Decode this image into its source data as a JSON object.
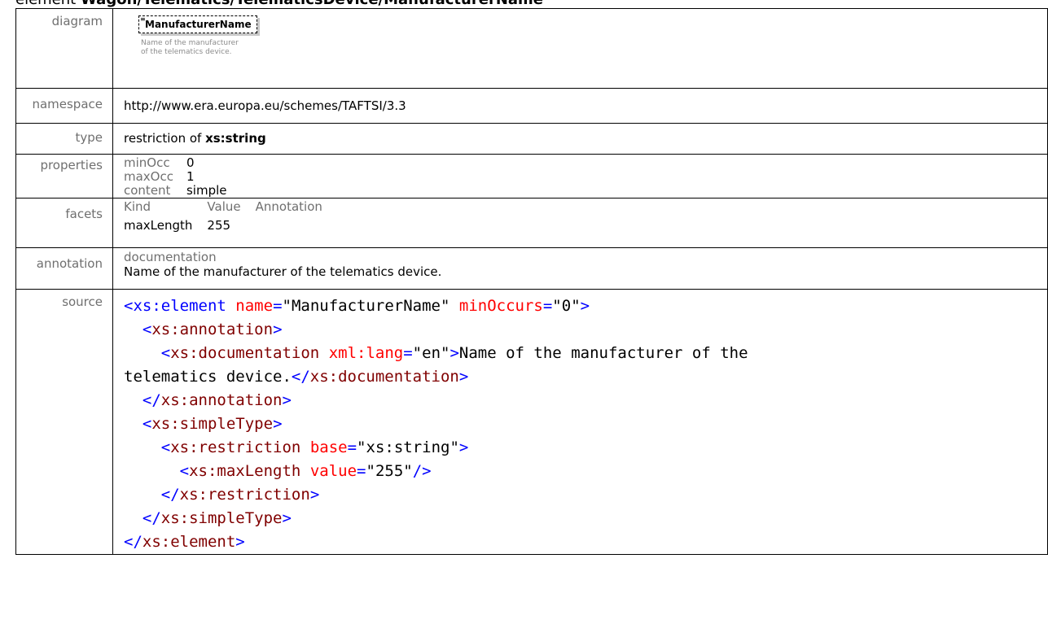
{
  "heading": {
    "prefix": "element ",
    "path": "Wagon/Telematics/TelematicsDevice/ManufacturerName"
  },
  "rows": {
    "diagram": {
      "label": "diagram",
      "element_name": "ManufacturerName",
      "doc_line1": "Name of the manufacturer",
      "doc_line2": "of the telematics device."
    },
    "namespace": {
      "label": "namespace",
      "value": "http://www.era.europa.eu/schemes/TAFTSI/3.3"
    },
    "type": {
      "label": "type",
      "prefix": "restriction of ",
      "base": "xs:string"
    },
    "properties": {
      "label": "properties",
      "items": [
        {
          "key": "minOcc",
          "value": "0"
        },
        {
          "key": "maxOcc",
          "value": "1"
        },
        {
          "key": "content",
          "value": "simple"
        }
      ]
    },
    "facets": {
      "label": "facets",
      "headers": [
        "Kind",
        "Value",
        "Annotation"
      ],
      "rows": [
        {
          "kind": "maxLength",
          "value": "255",
          "annotation": ""
        }
      ]
    },
    "annotation": {
      "label": "annotation",
      "heading": "documentation",
      "text": "Name of the manufacturer of the telematics device."
    },
    "source": {
      "label": "source",
      "el_open": "<xs:element",
      "name_attr": "name",
      "name_val": "ManufacturerName",
      "min_attr": "minOccurs",
      "min_val": "0",
      "annotation_tag": "xs:annotation",
      "documentation_tag": "xs:documentation",
      "lang_attr": "xml:lang",
      "lang_val": "en",
      "doc_text_1": "Name of the manufacturer of the",
      "doc_text_2": "telematics device.",
      "simpletype_tag": "xs:simpleType",
      "restriction_tag": "xs:restriction",
      "base_attr": "base",
      "base_val": "xs:string",
      "maxlength_tag": "xs:maxLength",
      "value_attr": "value",
      "value_val": "255",
      "element_tag": "xs:element"
    }
  }
}
